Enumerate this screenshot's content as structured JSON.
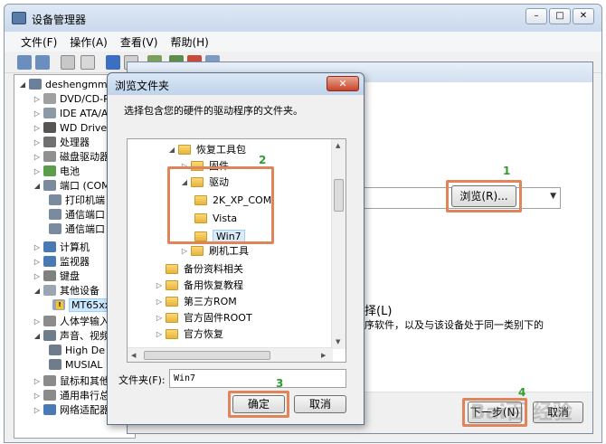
{
  "main_window": {
    "title": "设备管理器",
    "controls": {
      "minimize": "–",
      "maximize": "□",
      "close": "✕"
    }
  },
  "menu": [
    {
      "label": "文件(F)"
    },
    {
      "label": "操作(A)"
    },
    {
      "label": "查看(V)"
    },
    {
      "label": "帮助(H)"
    }
  ],
  "device_tree": {
    "root": "deshengmmo",
    "items": [
      {
        "label": "DVD/CD-R"
      },
      {
        "label": "IDE ATA/A"
      },
      {
        "label": "WD Drive"
      },
      {
        "label": "处理器"
      },
      {
        "label": "磁盘驱动器"
      },
      {
        "label": "电池"
      },
      {
        "label": "端口 (COM"
      },
      {
        "label": "打印机端"
      },
      {
        "label": "通信端口"
      },
      {
        "label": "通信端口"
      },
      {
        "label": "计算机"
      },
      {
        "label": "监视器"
      },
      {
        "label": "键盘"
      },
      {
        "label": "其他设备"
      },
      {
        "label": "MT65xx"
      },
      {
        "label": "人体学输入"
      },
      {
        "label": "声音、视频"
      },
      {
        "label": "High De"
      },
      {
        "label": "MUSIAL"
      },
      {
        "label": "鼠标和其他"
      },
      {
        "label": "通用串行总"
      },
      {
        "label": "网络适配器"
      }
    ]
  },
  "wizard": {
    "browse_button": "浏览(R)...",
    "text1": "择(L)",
    "text2": "序软件，以及与该设备处于同一类别下的",
    "next_button": "下一步(N)",
    "cancel_button": "取消"
  },
  "browse_dialog": {
    "title": "浏览文件夹",
    "close": "✕",
    "instruction": "选择包含您的硬件的驱动程序的文件夹。",
    "tree": [
      {
        "label": "恢复工具包"
      },
      {
        "label": "固件"
      },
      {
        "label": "驱动"
      },
      {
        "label": "2K_XP_COM"
      },
      {
        "label": "Vista"
      },
      {
        "label": "Win7"
      },
      {
        "label": "刷机工具"
      },
      {
        "label": "备份资料相关"
      },
      {
        "label": "备用恢复教程"
      },
      {
        "label": "第三方ROM"
      },
      {
        "label": "官方固件ROOT"
      },
      {
        "label": "官方恢复"
      }
    ],
    "folder_label": "文件夹(F):",
    "folder_value": "Win7",
    "ok_button": "确定",
    "cancel_button": "取消"
  },
  "step_labels": {
    "one": "1",
    "two": "2",
    "three": "3",
    "four": "4"
  },
  "watermark": "Bai百 经验",
  "colors": {
    "highlight": "#e0855a",
    "step_number": "#2e9e2e",
    "folder": "#e9b53b"
  }
}
